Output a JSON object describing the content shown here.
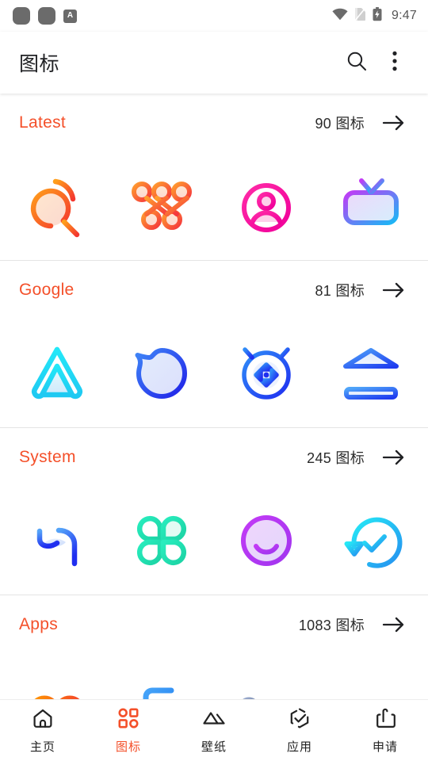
{
  "statusbar": {
    "notification_icons": [
      "notification-dot-1",
      "notification-dot-2"
    ],
    "badge_label": "A",
    "wifi_icon": "wifi-icon",
    "sim_icon": "no-sim-icon",
    "battery_icon": "battery-charging-icon",
    "time": "9:47"
  },
  "toolbar": {
    "title": "图标",
    "search_icon": "search-icon",
    "overflow_icon": "more-vertical-icon"
  },
  "accent_color": "#f4502a",
  "text_color": "#202124",
  "sections": [
    {
      "id": "latest",
      "title": "Latest",
      "count": "90 图标",
      "arrow_icon": "arrow-right-icon",
      "icons": [
        {
          "name": "search-magnifier-icon",
          "color_from": "#ff9800",
          "color_to": "#f44336"
        },
        {
          "name": "knot-loops-icon",
          "color_from": "#ff9d2e",
          "color_to": "#f5373d"
        },
        {
          "name": "robot-avatar-icon",
          "color_from": "#ff1fa0",
          "color_to": "#f5009b"
        },
        {
          "name": "television-icon",
          "color_from": "#c23bf5",
          "color_to": "#18b9f5"
        }
      ]
    },
    {
      "id": "google",
      "title": "Google",
      "count": "81 图标",
      "arrow_icon": "arrow-right-icon",
      "icons": [
        {
          "name": "android-auto-arrow-icon",
          "color_from": "#20e0f5",
          "color_to": "#17c8f0"
        },
        {
          "name": "chat-bubble-lines-icon",
          "color_from": "#3f7df5",
          "color_to": "#2020e8"
        },
        {
          "name": "find-my-device-icon",
          "color_from": "#2f7ef7",
          "color_to": "#1f2ef0"
        },
        {
          "name": "bank-building-icon",
          "color_from": "#3f9df8",
          "color_to": "#1f3cf0"
        }
      ]
    },
    {
      "id": "system",
      "title": "System",
      "count": "245 图标",
      "arrow_icon": "arrow-right-icon",
      "icons": [
        {
          "name": "hi-lens-icon",
          "color_from": "#4f9ff7",
          "color_to": "#1f2ef0"
        },
        {
          "name": "four-leaf-clover-icon",
          "color_from": "#24e3b8",
          "color_to": "#1fd6a6"
        },
        {
          "name": "smiley-face-icon",
          "color_from": "#c23bf5",
          "color_to": "#a23af0"
        },
        {
          "name": "restore-check-icon",
          "color_from": "#25e6f5",
          "color_to": "#2490f0"
        }
      ]
    },
    {
      "id": "apps",
      "title": "Apps",
      "count": "1083 图标",
      "arrow_icon": "arrow-right-icon",
      "icons": [
        {
          "name": "cloud-blob-icon",
          "color_from": "#ff9800",
          "color_to": "#f4422a"
        },
        {
          "name": "bracket-shape-icon",
          "color_from": "#3f9df8",
          "color_to": "#1f7cf0"
        },
        {
          "name": "wave-letters-icon",
          "color_from": "#8fa2c8",
          "color_to": "#5f6f96"
        },
        {
          "name": "rounded-square-dot-icon",
          "color_from": "#21e6d0",
          "color_to": "#18d8c0"
        }
      ]
    }
  ],
  "bottomnav": {
    "items": [
      {
        "id": "home",
        "label": "主页",
        "icon": "home-icon",
        "active": false
      },
      {
        "id": "icons",
        "label": "图标",
        "icon": "grid-apps-icon",
        "active": true
      },
      {
        "id": "wallpaper",
        "label": "壁纸",
        "icon": "mountain-image-icon",
        "active": false
      },
      {
        "id": "apps",
        "label": "应用",
        "icon": "hexagon-check-icon",
        "active": false
      },
      {
        "id": "request",
        "label": "申请",
        "icon": "upload-box-icon",
        "active": false
      }
    ]
  }
}
